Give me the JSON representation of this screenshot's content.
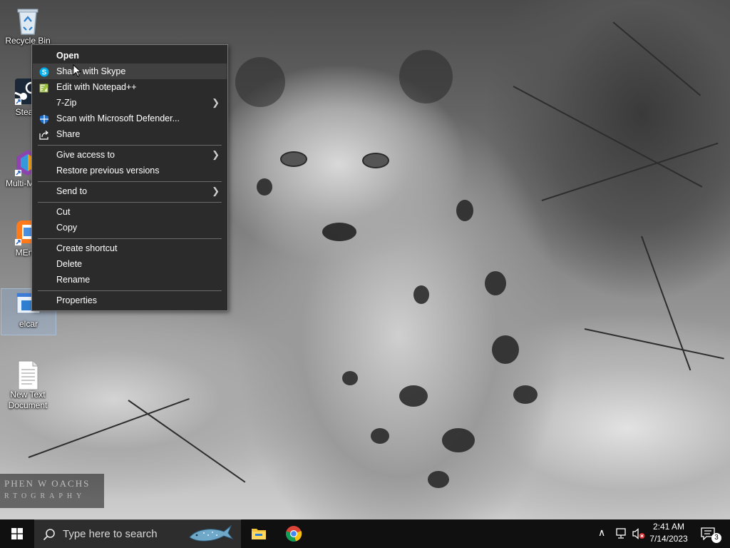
{
  "desktop": {
    "icons": [
      {
        "label": "Recycle Bin",
        "icon": "recycle-bin-icon"
      },
      {
        "label": "Steam",
        "icon": "steam-icon"
      },
      {
        "label": "Multi-Media",
        "icon": "shortcut-app-icon"
      },
      {
        "label": "MEmu",
        "icon": "memu-icon"
      },
      {
        "label": "elcar",
        "icon": "window-app-icon"
      },
      {
        "label": "New Text Document",
        "icon": "text-document-icon"
      }
    ],
    "wallpaper_watermark": {
      "line1": "PHEN W OACHS",
      "line2": "RTOGRAPHY"
    }
  },
  "context_menu": {
    "items": [
      {
        "label": "Open",
        "bold": true
      },
      {
        "label": "Share with Skype",
        "icon": "skype-icon",
        "highlighted": true
      },
      {
        "label": "Edit with Notepad++",
        "icon": "notepadpp-icon"
      },
      {
        "label": "7-Zip",
        "submenu": true
      },
      {
        "label": "Scan with Microsoft Defender...",
        "icon": "defender-shield-icon"
      },
      {
        "label": "Share",
        "icon": "share-icon"
      },
      {
        "label": "Give access to",
        "submenu": true
      },
      {
        "label": "Restore previous versions"
      },
      {
        "label": "Send to",
        "submenu": true
      },
      {
        "label": "Cut"
      },
      {
        "label": "Copy"
      },
      {
        "label": "Create shortcut"
      },
      {
        "label": "Delete"
      },
      {
        "label": "Rename"
      },
      {
        "label": "Properties"
      }
    ]
  },
  "taskbar": {
    "search_placeholder": "Type here to search",
    "apps": [
      "file-explorer-icon",
      "chrome-icon"
    ],
    "clock": {
      "time": "2:41 AM",
      "date": "7/14/2023"
    },
    "notifications_count": "3"
  },
  "colors": {
    "menu_bg": "#2b2b2b",
    "menu_hover": "#414141",
    "taskbar_bg": "#101010",
    "search_bg": "#2d2d2d",
    "skype_blue": "#00aff0",
    "defender_blue": "#1e6fd0"
  }
}
